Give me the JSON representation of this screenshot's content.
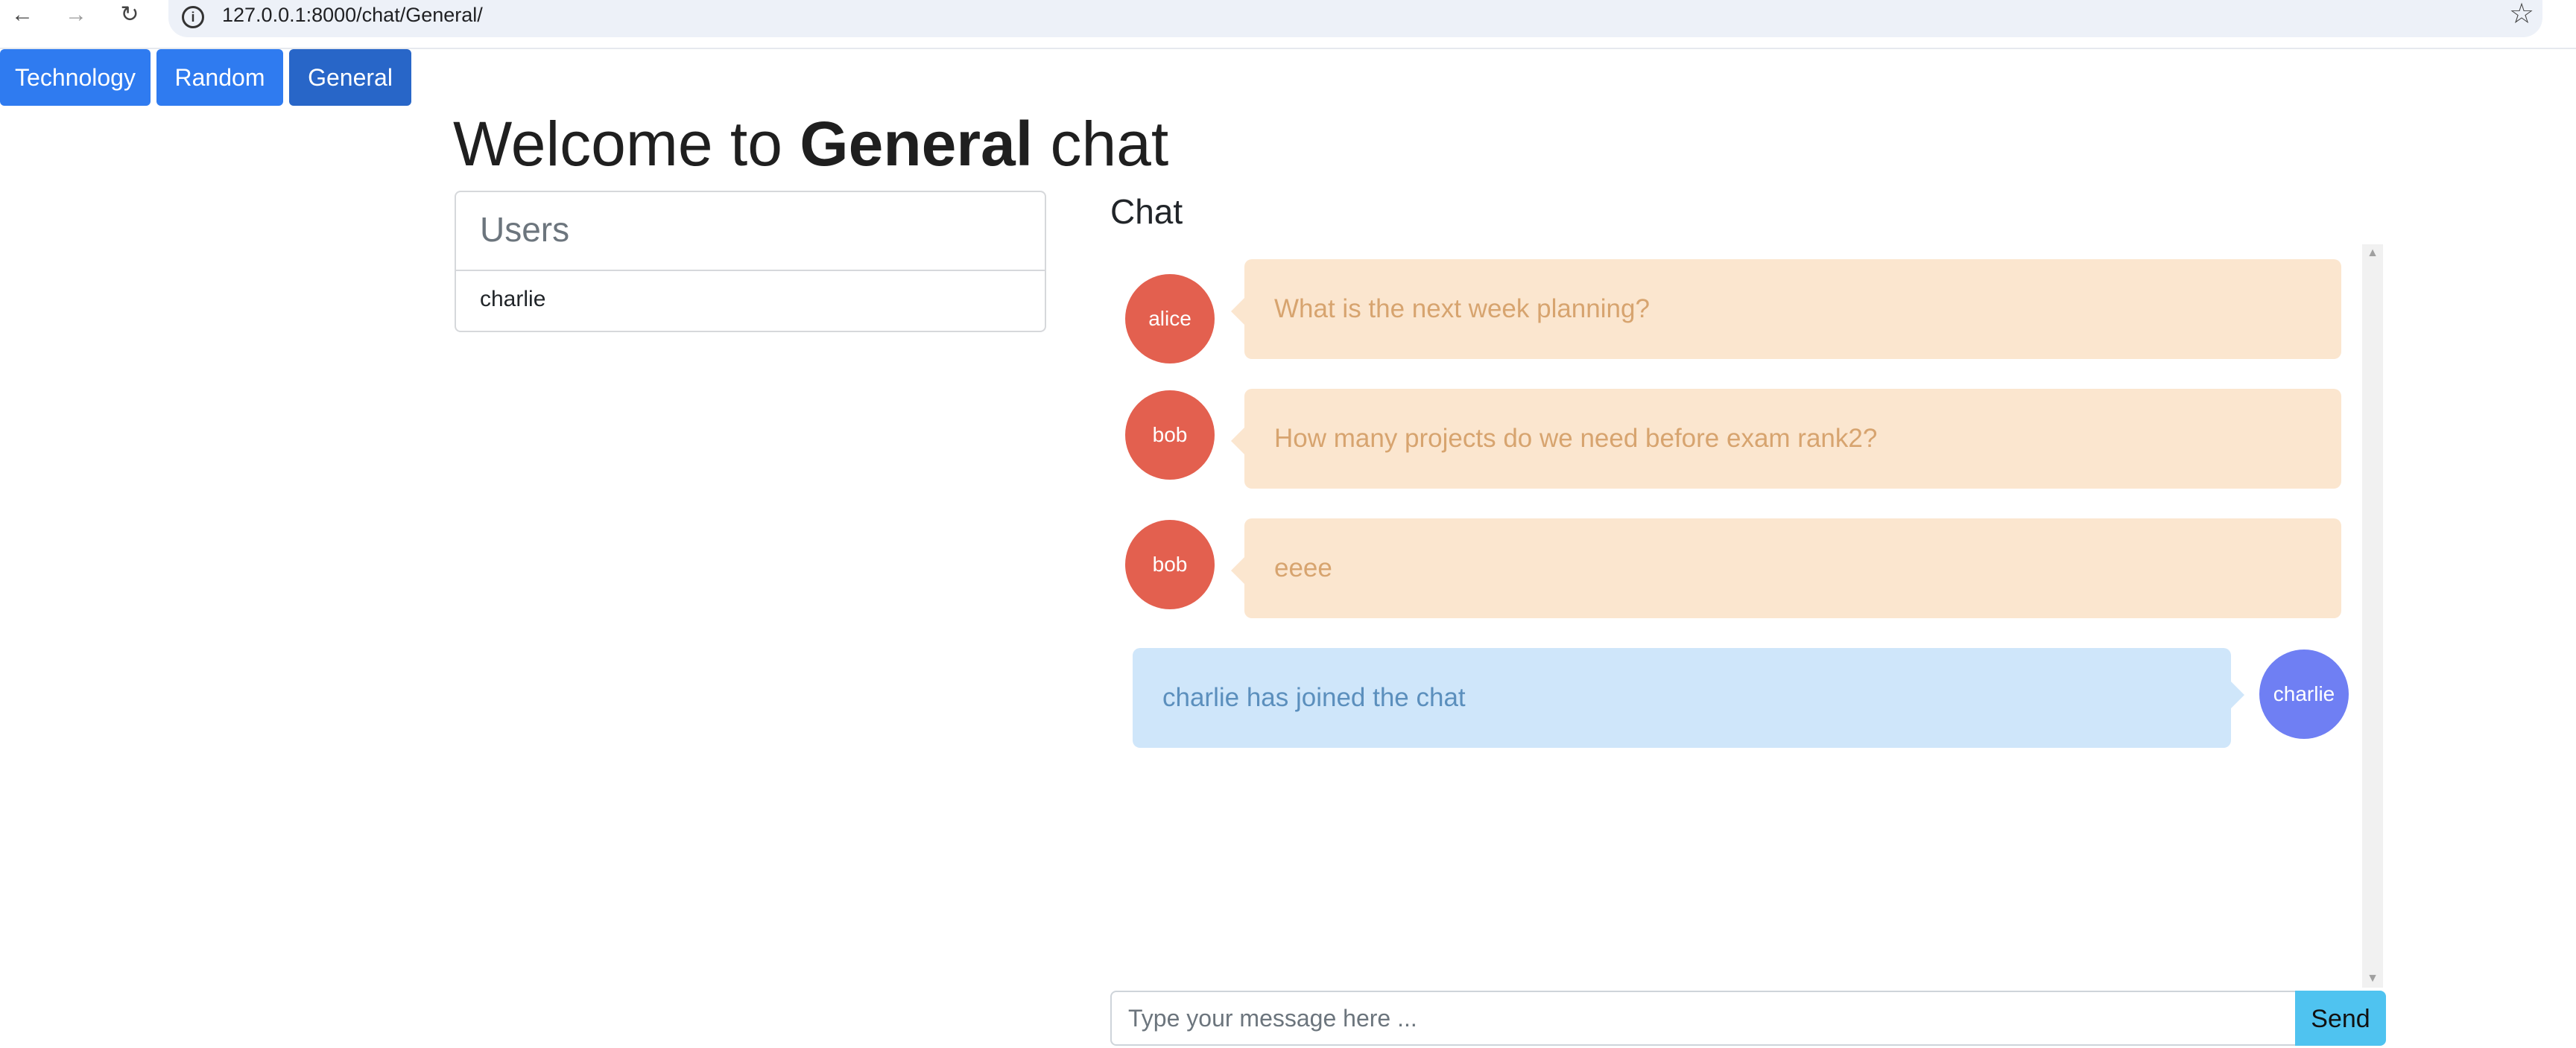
{
  "browser": {
    "back_icon": "←",
    "forward_icon": "→",
    "reload_icon": "↻",
    "info_icon": "i",
    "url": "127.0.0.1:8000/chat/General/",
    "bookmark_icon": "☆"
  },
  "rooms": [
    {
      "label": "Technology",
      "active": false
    },
    {
      "label": "Random",
      "active": false
    },
    {
      "label": "General",
      "active": true
    }
  ],
  "title": {
    "prefix": "Welcome to ",
    "room": "General",
    "suffix": " chat"
  },
  "users_panel": {
    "heading": "Users",
    "users": [
      "charlie"
    ]
  },
  "chat": {
    "heading": "Chat",
    "messages": [
      {
        "author": "alice",
        "text": "What is the next week planning?",
        "self": false
      },
      {
        "author": "bob",
        "text": "How many projects do we need before exam rank2?",
        "self": false
      },
      {
        "author": "bob",
        "text": "eeee",
        "self": false
      },
      {
        "author": "charlie",
        "text": "charlie has joined the chat",
        "self": true
      }
    ],
    "colors": {
      "other_avatar": "#e3604f",
      "self_avatar": "#6f7ff3",
      "other_bubble": "#fbe6cf",
      "self_bubble": "#cfe6fa"
    }
  },
  "composer": {
    "placeholder": "Type your message here ...",
    "value": "",
    "send_label": "Send"
  }
}
